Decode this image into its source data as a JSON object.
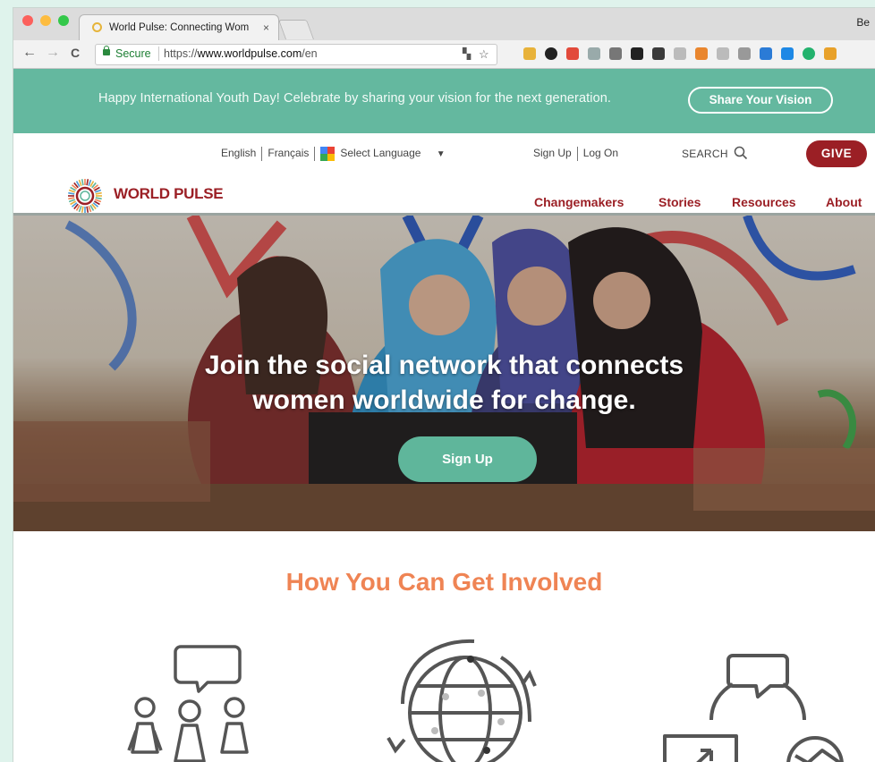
{
  "browser": {
    "tab_title": "World Pulse: Connecting Wom",
    "tab_close": "×",
    "tab_strip_right": "Be",
    "back": "←",
    "forward": "→",
    "reload": "C",
    "secure_label": "Secure",
    "url_scheme": "https://",
    "url_host": "www.worldpulse.com",
    "url_path": "/en",
    "star": "☆",
    "extension_icons": [
      "extension-1-icon",
      "extension-2-icon",
      "extension-3-icon",
      "extension-4-icon",
      "extension-5-icon",
      "extension-6-icon",
      "extension-7-icon",
      "extension-8-icon",
      "extension-9-icon",
      "extension-10-icon",
      "extension-11-icon",
      "extension-12-icon",
      "extension-13-icon",
      "extension-14-icon",
      "extension-15-icon"
    ]
  },
  "banner": {
    "text": "Happy International Youth Day! Celebrate by sharing your vision for the next generation.",
    "button": "Share Your Vision"
  },
  "header": {
    "lang_english": "English",
    "lang_french": "Français",
    "select_language": "Select Language",
    "select_arrow": "▼",
    "sign_up": "Sign Up",
    "log_on": "Log On",
    "search": "SEARCH",
    "give": "GIVE",
    "brand": "WORLD PULSE",
    "nav": [
      "Changemakers",
      "Stories",
      "Resources",
      "About"
    ]
  },
  "hero": {
    "headline_line1": "Join the social network that connects",
    "headline_line2": "women worldwide for change.",
    "cta": "Sign Up"
  },
  "involved": {
    "title": "How You Can Get Involved"
  },
  "colors": {
    "teal": "#64b89f",
    "brand_red": "#9b1f25",
    "orange": "#ef8454"
  }
}
